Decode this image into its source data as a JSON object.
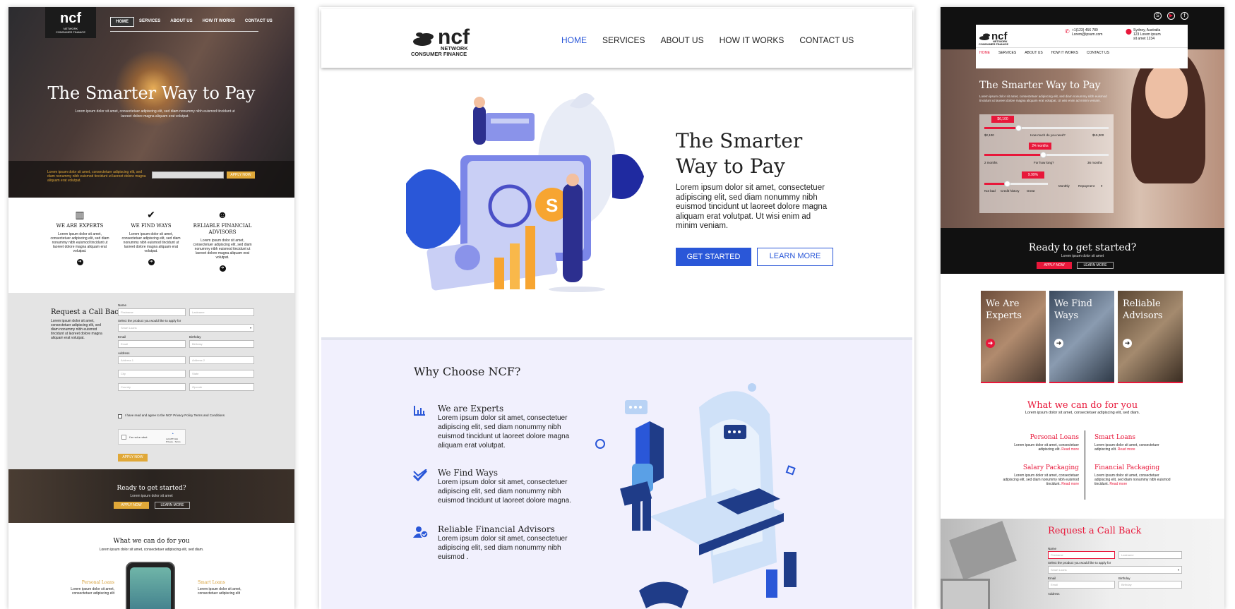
{
  "left": {
    "logo": {
      "brand": "ncf",
      "line1": "NETWORK",
      "line2": "CONSUMER FINANCE"
    },
    "nav": [
      "HOME",
      "SERVICES",
      "ABOUT US",
      "HOW IT WORKS",
      "CONTACT US"
    ],
    "hero_title": "The Smarter Way to Pay",
    "hero_sub": "Lorem ipsum dolor sit amet, consectetuer adipiscing elit, sed diam nonummy nibh euismod tincidunt ut laoreet dolore magna aliquam erat volutpat.",
    "strip_text": "Lorem ipsum dolor sit amet, consectetuer adipiscing elit, sed diam nonummy nibh euismod tincidunt ut laoreet dolore magna aliquam erat volutpat.",
    "strip_btn": "APPLY NOW",
    "features": [
      {
        "icon": "chart-icon",
        "title": "We Are Experts",
        "desc": "Lorem ipsum dolor sit amet, consectetuer adipiscing elit, sed diam nonummy nibh euismod tincidunt ut laoreet dolore magna aliquam erat volutpat."
      },
      {
        "icon": "check-icon",
        "title": "We Find Ways",
        "desc": "Lorem ipsum dolor sit amet, consectetuer adipiscing elit, sed diam nonummy nibh euismod tincidunt ut laoreet dolore magna aliquam erat volutpat."
      },
      {
        "icon": "advisor-icon",
        "title": "Reliable Financial Advisors",
        "desc": "Lorem ipsum dolor sit amet, consectetuer adipiscing elit, sed diam nonummy nibh euismod tincidunt ut laoreet dolore magna aliquam erat volutpat."
      }
    ],
    "callback": {
      "title": "Request a Call Back",
      "desc": "Lorem ipsum dolor sit amet, consectetuer adipiscing elit, sed diam nonummy nibh euismod tincidunt ut laoreet dolore magna aliquam erat volutpat.",
      "name_label": "Name",
      "firstname": "Firstname",
      "lastname": "Lastname",
      "product_label": "Select the product you would like to apply for",
      "product_value": "Smart Loans",
      "email_label": "Email",
      "email": "Email",
      "birthday_label": "Birthday",
      "birthday": "Birthday",
      "address_label": "Address",
      "address1": "Address 1",
      "address2": "Address 2",
      "city": "City",
      "state": "State",
      "country": "Country",
      "zipcode": "Zipcode",
      "agree": "I have read and agree to the NCF Privacy Policy Terms and Conditions",
      "robot": "I'm not a robot",
      "recaptcha": "reCAPTCHA",
      "privacy_terms": "Privacy - Terms",
      "apply": "APPLY NOW"
    },
    "ready": {
      "title": "Ready to get started?",
      "sub": "Lorem ipsum dolor sit amet",
      "apply": "APPLY NOW",
      "learn": "LEARN MORE"
    },
    "wwd_title": "What we can do for you",
    "wwd_sub": "Lorem ipsum dolor sit amet, consectetuer adipiscing elit, sed diam.",
    "svc1_title": "Personal Loans",
    "svc1_desc": "Lorem ipsum dolor sit amet, consectetuer adipiscing elit",
    "svc2_title": "Smart Loans",
    "svc2_desc": "Lorem ipsum dolor sit amet, consectetuer adipiscing elit"
  },
  "middle": {
    "logo": {
      "brand": "ncf",
      "line1": "NETWORK",
      "line2": "CONSUMER FINANCE"
    },
    "nav": [
      "HOME",
      "SERVICES",
      "ABOUT US",
      "HOW IT WORKS",
      "CONTACT US"
    ],
    "title1": "The Smarter",
    "title2": "Way to Pay",
    "desc": "Lorem ipsum dolor sit amet, consectetuer adipiscing elit, sed diam nonummy nibh euismod tincidunt ut laoreet dolore magna aliquam erat volutpat. Ut wisi enim ad minim veniam.",
    "btn_start": "GET STARTED",
    "btn_learn": "LEARN MORE",
    "why_title": "Why Choose NCF?",
    "why_items": [
      {
        "icon": "chart-icon",
        "title": "We are Experts",
        "desc": "Lorem ipsum dolor sit amet, consectetuer adipiscing elit, sed diam nonummy nibh euismod tincidunt ut laoreet dolore magna aliquam erat volutpat."
      },
      {
        "icon": "check-icon",
        "title": "We Find Ways",
        "desc": "Lorem ipsum dolor sit amet, consectetuer adipiscing elit, sed diam nonummy nibh euismod tincidunt ut laoreet dolore magna."
      },
      {
        "icon": "advisor-icon",
        "title": "Reliable Financial Advisors",
        "desc": "Lorem ipsum dolor sit amet, consectetuer adipiscing elit, sed diam nonummy nibh euismod ."
      }
    ],
    "accent": "#2a57d8"
  },
  "right": {
    "logo": {
      "brand": "ncf",
      "line1": "NETWORK",
      "line2": "CONSUMER FINANCE"
    },
    "phone": "+1(123) 456 789",
    "email": "Lorem@ipsum.com",
    "address1": "Sydney, Australia",
    "address2": "123 Lorem ipsum",
    "address3": "sit amet 1234",
    "nav": [
      "HOME",
      "SERVICES",
      "ABOUT US",
      "HOW IT WORKS",
      "CONTACT US"
    ],
    "hero_title": "The Smarter Way to Pay",
    "hero_sub": "Lorem ipsum dolor sit amet, consectetuer adipiscing elit, sed diam nonummy nibh euismod tincidunt ut laoreet dolore magna aliquam erat volutpat. Ut wisi enim ad minim veniam.",
    "calc": {
      "amount": "$6,100",
      "amount_min": "$2,100",
      "amount_max": "$15,000",
      "amount_label": "How much do you need?",
      "amount_level": 0.27,
      "term": "24 months",
      "term_min": "2 months",
      "term_max": "36 months",
      "term_label": "For how long?",
      "term_level": 0.47,
      "rate": "9.99%",
      "rate_min": "Not bad",
      "rate_mid": "Credit history",
      "rate_max": "Great",
      "rate_level": 0.36,
      "repay_label": "Repayment",
      "repay_value": "Monthly"
    },
    "ready": {
      "title": "Ready to get started?",
      "sub": "Lorem ipsum dolor sit amet",
      "apply": "APPLY NOW",
      "learn": "LEARN MORE"
    },
    "cards": [
      {
        "title1": "We Are",
        "title2": "Experts"
      },
      {
        "title1": "We Find",
        "title2": "Ways"
      },
      {
        "title1": "Reliable",
        "title2": "Advisors"
      }
    ],
    "wwd_title": "What we can do for you",
    "wwd_sub": "Lorem ipsum dolor sit amet, consectetuer adipiscing elit, sed diam.",
    "services": [
      {
        "title": "Personal Loans",
        "desc": "Lorem ipsum dolor sit amet, consectetuer adipiscing elit.",
        "more": "Read more"
      },
      {
        "title": "Smart Loans",
        "desc": "Lorem ipsum dolor sit amet, consectetuer adipiscing elit.",
        "more": "Read more"
      },
      {
        "title": "Salary Packaging",
        "desc": "Lorem ipsum dolor sit amet, consectetuer adipiscing elit, sed diam nonummy nibh euismod tincidunt.",
        "more": "Read more"
      },
      {
        "title": "Financial Packaging",
        "desc": "Lorem ipsum dolor sit amet, consectetuer adipiscing elit, sed diam nonummy nibh euismod tincidunt.",
        "more": "Read more"
      }
    ],
    "callback": {
      "title": "Request a Call Back",
      "name_label": "Name",
      "firstname": "Firstname",
      "lastname": "Lastname",
      "product_label": "Select the product you would like to apply for",
      "product_value": "Smart Loans",
      "email_label": "Email",
      "email": "Email",
      "birthday_label": "Birthday",
      "birthday": "Birthday",
      "address_label": "Address"
    },
    "accent": "#e8173a"
  }
}
